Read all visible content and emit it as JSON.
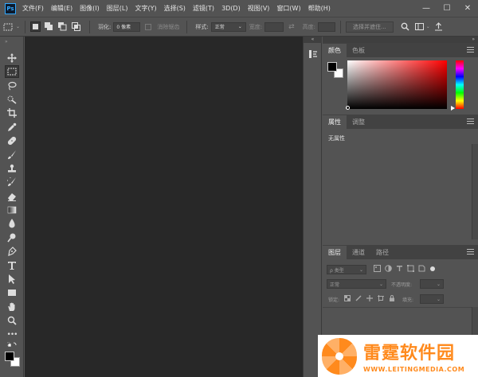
{
  "app": {
    "logo_text": "Ps"
  },
  "menu": {
    "items": [
      "文件(F)",
      "编辑(E)",
      "图像(I)",
      "图层(L)",
      "文字(Y)",
      "选择(S)",
      "滤镜(T)",
      "3D(D)",
      "视图(V)",
      "窗口(W)",
      "帮助(H)"
    ]
  },
  "options": {
    "feather_label": "羽化:",
    "feather_value": "0 像素",
    "antialias_label": "消除锯齿",
    "style_label": "样式:",
    "style_value": "正常",
    "width_label": "宽度:",
    "height_label": "高度:",
    "select_subject_button": "选择并遮住..."
  },
  "color_panel": {
    "tabs": [
      "颜色",
      "色板"
    ],
    "foreground": "#000000",
    "background": "#ffffff"
  },
  "properties_panel": {
    "tabs": [
      "属性",
      "调整"
    ],
    "status": "无属性"
  },
  "layers_panel": {
    "tabs": [
      "图层",
      "通道",
      "路径"
    ],
    "filter_placeholder": "ρ 类型",
    "blend_mode": "正常",
    "opacity_label": "不透明度:",
    "lock_label": "锁定:",
    "fill_label": "填充:"
  },
  "watermark": {
    "title": "雷霆软件园",
    "url": "WWW.LEITINGMEDIA.COM"
  },
  "colors": {
    "ui_bg": "#535353",
    "canvas_bg": "#282828",
    "accent_orange": "#ff8a1d",
    "ps_blue": "#31a8ff"
  }
}
